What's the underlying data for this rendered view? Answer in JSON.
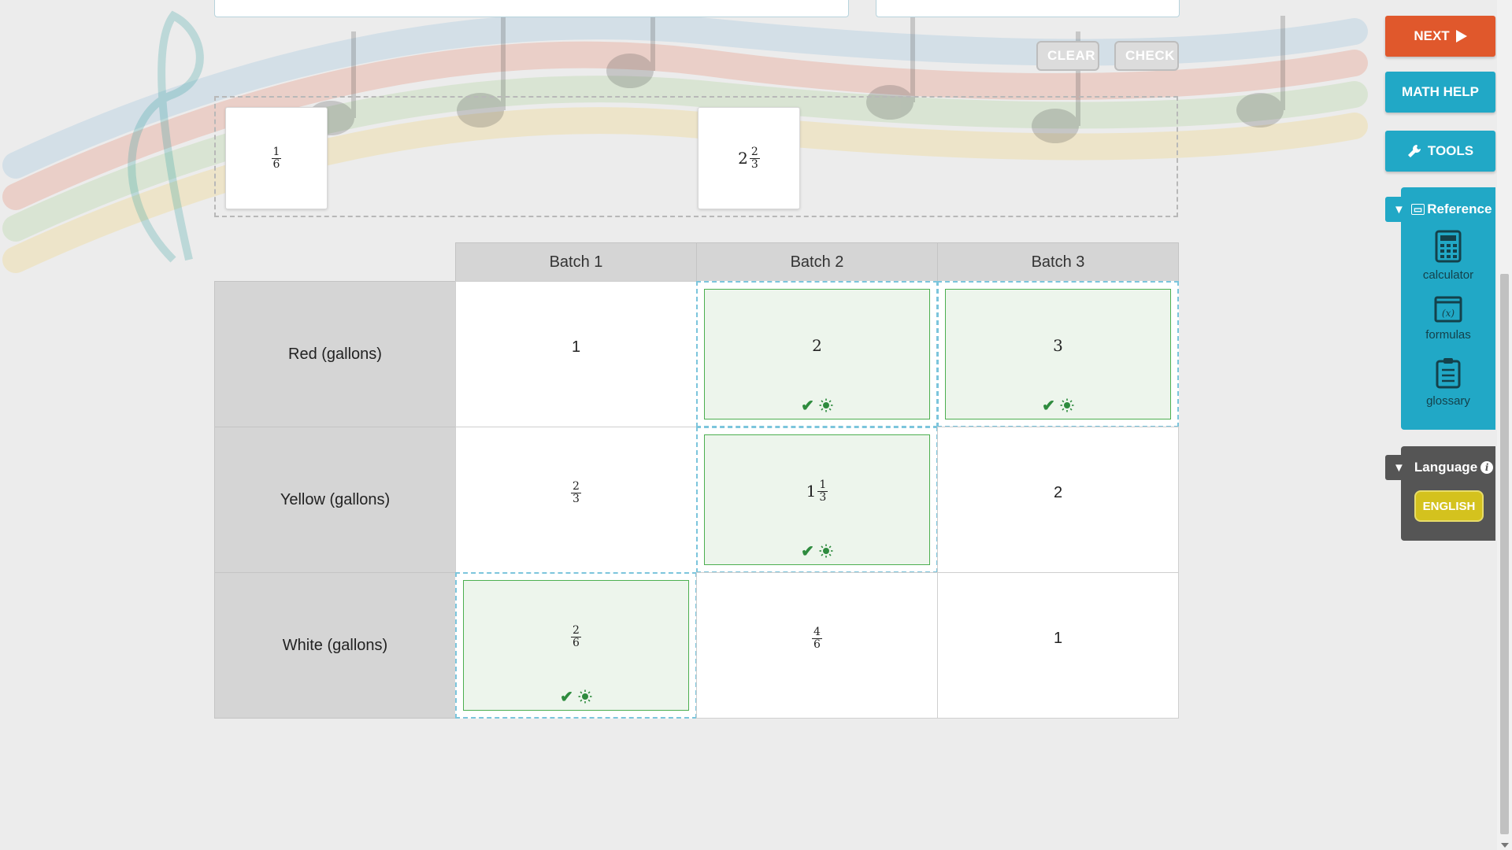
{
  "toolbar": {
    "clear_label": "CLEAR",
    "check_label": "CHECK"
  },
  "bank": {
    "tiles": [
      {
        "whole": "",
        "num": "1",
        "den": "6"
      },
      {
        "whole": "2",
        "num": "2",
        "den": "3"
      }
    ]
  },
  "table": {
    "columns": [
      "Batch 1",
      "Batch 2",
      "Batch 3"
    ],
    "rows": [
      {
        "label": "Red (gallons)"
      },
      {
        "label": "Yellow (gallons)"
      },
      {
        "label": "White (gallons)"
      }
    ],
    "cells": {
      "r0c0": "1",
      "r0c1": "2",
      "r0c2": "3",
      "r1c0": {
        "num": "2",
        "den": "3"
      },
      "r1c1": {
        "whole": "1",
        "num": "1",
        "den": "3"
      },
      "r1c2": "2",
      "r2c0": {
        "num": "2",
        "den": "6"
      },
      "r2c1": {
        "num": "4",
        "den": "6"
      },
      "r2c2": "1"
    }
  },
  "sidebar": {
    "next_label": "NEXT",
    "math_help_label": "MATH HELP",
    "tools_label": "TOOLS",
    "reference_label": "Reference",
    "reference_items": [
      "calculator",
      "formulas",
      "glossary"
    ],
    "language_label": "Language",
    "language_value": "ENGLISH"
  },
  "icons": {
    "answer_marks": [
      "check-icon",
      "lightbulb-icon"
    ],
    "sidebar": [
      "play-icon",
      "wrench-icon",
      "calculator-icon",
      "formula-icon",
      "clipboard-icon",
      "info-icon"
    ]
  },
  "colors": {
    "next": "#e0582c",
    "help": "#21a8c6",
    "correct": "#4caf50",
    "language": "#d4c21e"
  }
}
